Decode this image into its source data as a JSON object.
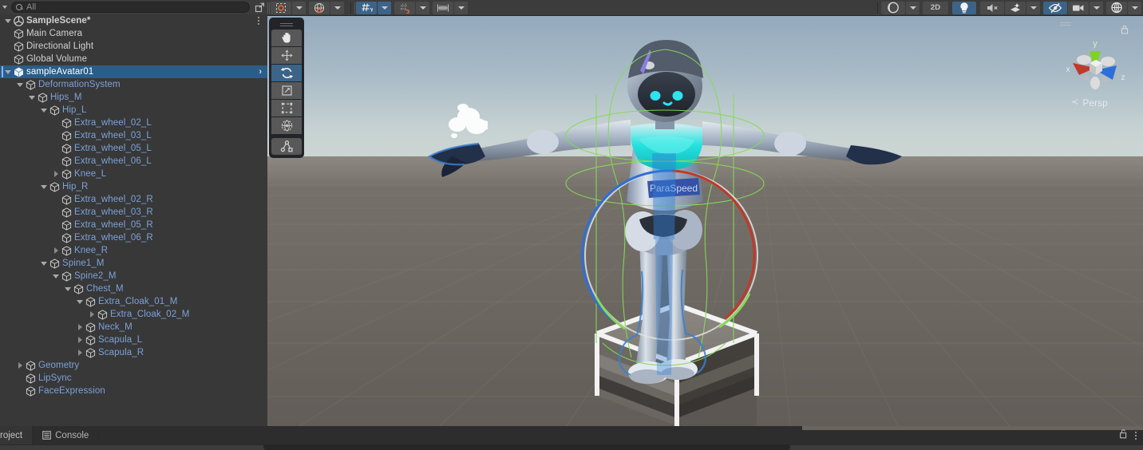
{
  "app": {
    "name": "Unity Editor",
    "theme": "dark"
  },
  "colors": {
    "panel_bg": "#383838",
    "toolbar_bg": "#3c3c3c",
    "selection_blue": "#2c5d87",
    "active_toggle_blue": "#3c6488",
    "prefab_child_text": "#7ba2d9",
    "normal_text": "#d2d2d2",
    "ground": "#6b6560",
    "sky_top": "#8fa3b8",
    "sky_horizon": "#c8d4d4",
    "axis_x": "#c0392b",
    "axis_y": "#7ed321",
    "axis_z": "#2d6fd8"
  },
  "hierarchy": {
    "search": {
      "placeholder": "All",
      "value": "",
      "icon": "search-icon"
    },
    "expand_button_icon": "open-in-new-icon",
    "scene": {
      "name": "SampleScene*",
      "icon": "unity-scene-icon",
      "menu_icon": "kebab-menu-icon"
    },
    "rows": [
      {
        "label": "Main Camera",
        "indent": 1,
        "fold": "none",
        "icon": "gameobject-icon",
        "style": "white"
      },
      {
        "label": "Directional Light",
        "indent": 1,
        "fold": "none",
        "icon": "gameobject-icon",
        "style": "white"
      },
      {
        "label": "Global Volume",
        "indent": 1,
        "fold": "none",
        "icon": "gameobject-icon",
        "style": "white"
      },
      {
        "label": "sampleAvatar01",
        "indent": 1,
        "fold": "down",
        "icon": "prefab-icon",
        "style": "selected",
        "selected": true,
        "chevron": "›"
      },
      {
        "label": "DeformationSystem",
        "indent": 2,
        "fold": "down",
        "icon": "gameobject-icon",
        "style": "prefab"
      },
      {
        "label": "Hips_M",
        "indent": 3,
        "fold": "down",
        "icon": "gameobject-icon",
        "style": "prefab"
      },
      {
        "label": "Hip_L",
        "indent": 4,
        "fold": "down",
        "icon": "gameobject-icon",
        "style": "prefab"
      },
      {
        "label": "Extra_wheel_02_L",
        "indent": 5,
        "fold": "none",
        "icon": "gameobject-icon",
        "style": "prefab"
      },
      {
        "label": "Extra_wheel_03_L",
        "indent": 5,
        "fold": "none",
        "icon": "gameobject-icon",
        "style": "prefab"
      },
      {
        "label": "Extra_wheel_05_L",
        "indent": 5,
        "fold": "none",
        "icon": "gameobject-icon",
        "style": "prefab"
      },
      {
        "label": "Extra_wheel_06_L",
        "indent": 5,
        "fold": "none",
        "icon": "gameobject-icon",
        "style": "prefab"
      },
      {
        "label": "Knee_L",
        "indent": 5,
        "fold": "right",
        "icon": "gameobject-icon",
        "style": "prefab"
      },
      {
        "label": "Hip_R",
        "indent": 4,
        "fold": "down",
        "icon": "gameobject-icon",
        "style": "prefab"
      },
      {
        "label": "Extra_wheel_02_R",
        "indent": 5,
        "fold": "none",
        "icon": "gameobject-icon",
        "style": "prefab"
      },
      {
        "label": "Extra_wheel_03_R",
        "indent": 5,
        "fold": "none",
        "icon": "gameobject-icon",
        "style": "prefab"
      },
      {
        "label": "Extra_wheel_05_R",
        "indent": 5,
        "fold": "none",
        "icon": "gameobject-icon",
        "style": "prefab"
      },
      {
        "label": "Extra_wheel_06_R",
        "indent": 5,
        "fold": "none",
        "icon": "gameobject-icon",
        "style": "prefab"
      },
      {
        "label": "Knee_R",
        "indent": 5,
        "fold": "right",
        "icon": "gameobject-icon",
        "style": "prefab"
      },
      {
        "label": "Spine1_M",
        "indent": 4,
        "fold": "down",
        "icon": "gameobject-icon",
        "style": "prefab"
      },
      {
        "label": "Spine2_M",
        "indent": 5,
        "fold": "down",
        "icon": "gameobject-icon",
        "style": "prefab"
      },
      {
        "label": "Chest_M",
        "indent": 6,
        "fold": "down",
        "icon": "gameobject-icon",
        "style": "prefab"
      },
      {
        "label": "Extra_Cloak_01_M",
        "indent": 7,
        "fold": "down",
        "icon": "gameobject-icon",
        "style": "prefab"
      },
      {
        "label": "Extra_Cloak_02_M",
        "indent": 8,
        "fold": "right",
        "icon": "gameobject-icon",
        "style": "prefab"
      },
      {
        "label": "Neck_M",
        "indent": 7,
        "fold": "right",
        "icon": "gameobject-icon",
        "style": "prefab"
      },
      {
        "label": "Scapula_L",
        "indent": 7,
        "fold": "right",
        "icon": "gameobject-icon",
        "style": "prefab"
      },
      {
        "label": "Scapula_R",
        "indent": 7,
        "fold": "right",
        "icon": "gameobject-icon",
        "style": "prefab"
      },
      {
        "label": "Geometry",
        "indent": 2,
        "fold": "right",
        "icon": "gameobject-icon",
        "style": "prefab"
      },
      {
        "label": "LipSync",
        "indent": 2,
        "fold": "none",
        "icon": "gameobject-icon",
        "style": "prefab"
      },
      {
        "label": "FaceExpression",
        "indent": 2,
        "fold": "none",
        "icon": "gameobject-icon",
        "style": "prefab"
      }
    ]
  },
  "scene_toolbar": {
    "left_items": [
      {
        "name": "pivot-mode-button",
        "icon": "pivot-center-icon",
        "active": false,
        "dropdown": true
      },
      {
        "name": "handle-orientation-button",
        "icon": "global-local-icon",
        "active": false,
        "dropdown": true
      },
      {
        "name": "grid-visibility-button",
        "icon": "grid-axis-y-icon",
        "active": true,
        "dropdown": true,
        "label": "Y"
      },
      {
        "name": "grid-snapping-button",
        "icon": "grid-snap-icon",
        "active": false,
        "dropdown": true
      },
      {
        "name": "increment-snap-button",
        "icon": "increment-snap-icon",
        "active": false,
        "dropdown": true
      }
    ],
    "right_items": [
      {
        "name": "draw-mode-button",
        "icon": "shaded-sphere-icon",
        "active": false,
        "dropdown": true
      },
      {
        "name": "2d-toggle-button",
        "icon": "2d-text-icon",
        "active": false,
        "dropdown": false,
        "label": "2D"
      },
      {
        "name": "lighting-toggle",
        "icon": "lightbulb-icon",
        "active": true,
        "dropdown": false
      },
      {
        "name": "audio-toggle",
        "icon": "audio-mute-icon",
        "active": false,
        "dropdown": false
      },
      {
        "name": "effects-toggle",
        "icon": "fx-icon",
        "active": false,
        "dropdown": true
      },
      {
        "name": "scene-visibility-toggle",
        "icon": "eye-off-icon",
        "active": true,
        "dropdown": false
      },
      {
        "name": "camera-settings-button",
        "icon": "camera-icon",
        "active": false,
        "dropdown": true
      },
      {
        "name": "gizmos-toggle",
        "icon": "gizmo-sphere-icon",
        "active": false,
        "dropdown": true
      }
    ]
  },
  "tools_palette": {
    "grip": "drag-handle",
    "tools": [
      {
        "name": "hand-tool",
        "icon": "hand-icon",
        "active": false
      },
      {
        "name": "move-tool",
        "icon": "move-arrows-icon",
        "active": false
      },
      {
        "name": "rotate-tool",
        "icon": "rotate-icon",
        "active": true
      },
      {
        "name": "scale-tool",
        "icon": "scale-icon",
        "active": false
      },
      {
        "name": "rect-tool",
        "icon": "rect-transform-icon",
        "active": false
      },
      {
        "name": "transform-tool",
        "icon": "transform-icon",
        "active": false
      },
      {
        "name": "custom-editor-tool",
        "icon": "avatar-joint-icon",
        "active": false
      }
    ]
  },
  "scene_gizmo": {
    "projection_label": "Persp",
    "axis_x_label": "x",
    "axis_y_label": "y",
    "axis_z_label": "z",
    "lock_icon": "lock-icon",
    "grip_icon": "drag-handle-icon",
    "back_arrow": "≺"
  },
  "scene_content": {
    "selected_object": "sampleAvatar01",
    "description": "Humanoid robot avatar in T-pose with green selection outline, rotation gizmo rings and white wireframe bounds cube",
    "chest_decal_text": "ParaSpeed",
    "gizmo_rings": [
      "#c0392b",
      "#2d6fd8",
      "#7ed321",
      "#e8e8e8"
    ],
    "selection_outline": "#7ed321"
  },
  "bottom_bar": {
    "tabs": [
      {
        "name": "tab-project",
        "label": "roject",
        "icon": "",
        "active": true
      },
      {
        "name": "tab-console",
        "label": "Console",
        "icon": "console-icon",
        "active": false
      }
    ],
    "lock_icon": "lock-open-icon",
    "menu_icon": "kebab-menu-icon"
  }
}
